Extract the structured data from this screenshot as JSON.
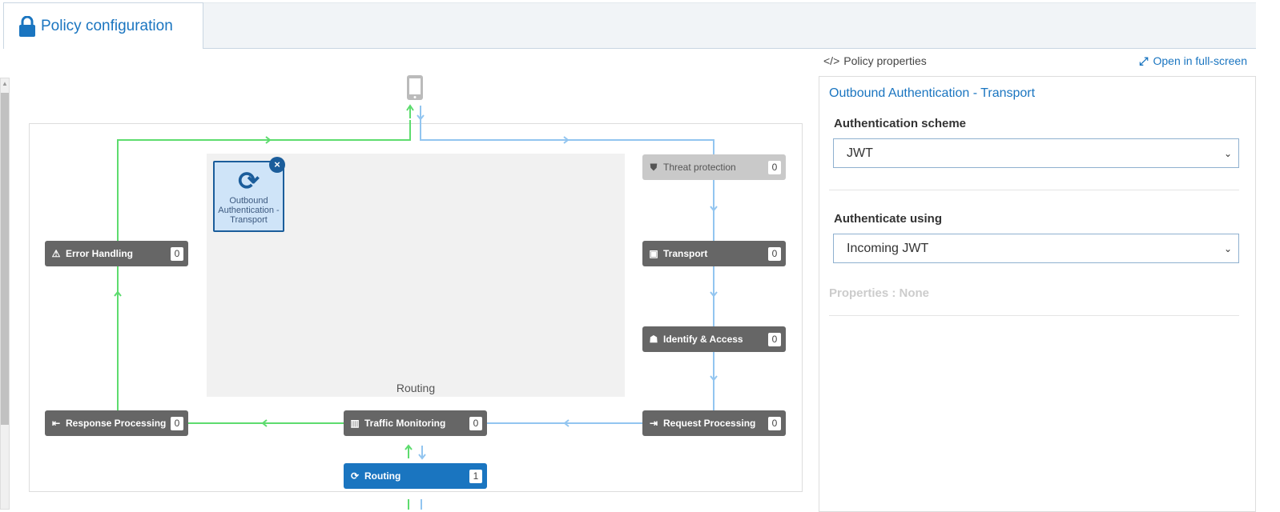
{
  "tab": {
    "title": "Policy configuration",
    "icon": "lock-icon"
  },
  "diagram": {
    "area_label": "Routing",
    "selected_policy": {
      "label": "Outbound Authentication - Transport",
      "icon": "refresh-icon"
    },
    "nodes": [
      {
        "label": "Error Handling",
        "count": "0",
        "icon": "warning-icon"
      },
      {
        "label": "Threat protection",
        "count": "0",
        "icon": "shield-icon"
      },
      {
        "label": "Transport",
        "count": "0",
        "icon": "bus-icon"
      },
      {
        "label": "Identify & Access",
        "count": "0",
        "icon": "user-secret-icon"
      },
      {
        "label": "Request Processing",
        "count": "0",
        "icon": "sign-in-icon"
      },
      {
        "label": "Traffic Monitoring",
        "count": "0",
        "icon": "bar-chart-icon"
      },
      {
        "label": "Response Processing",
        "count": "0",
        "icon": "sign-out-icon"
      },
      {
        "label": "Routing",
        "count": "1",
        "icon": "refresh-icon"
      }
    ]
  },
  "panel": {
    "header": "Policy properties",
    "fullscreen": "Open in full-screen",
    "title": "Outbound Authentication - Transport",
    "scheme_label": "Authentication scheme",
    "scheme_value": "JWT",
    "using_label": "Authenticate using",
    "using_value": "Incoming JWT",
    "properties": "Properties : None"
  },
  "colors": {
    "accent": "#1a75c0",
    "green_flow": "#5ddc6e",
    "blue_flow": "#92c5f0",
    "node": "#666666"
  }
}
